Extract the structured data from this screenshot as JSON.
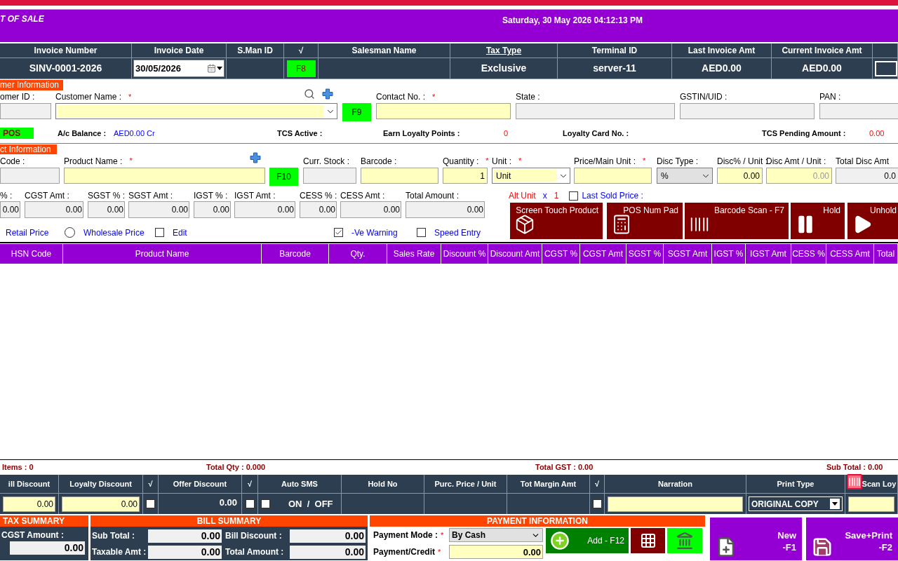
{
  "title_bar": {
    "title": "T OF SALE",
    "datetime": "Saturday, 30 May 2026 04:12:13 PM"
  },
  "invoice_header": [
    {
      "label": "Invoice Number",
      "kind": "text",
      "value": "SINV-0001-2026",
      "underlined": false
    },
    {
      "label": "Invoice Date",
      "kind": "date",
      "value": "30/05/2026",
      "underlined": false
    },
    {
      "label": "S.Man ID",
      "kind": "empty",
      "underlined": false
    },
    {
      "label": "√",
      "kind": "key",
      "value": "F8",
      "underlined": false
    },
    {
      "label": "Salesman Name",
      "kind": "empty",
      "underlined": false
    },
    {
      "label": "Tax Type",
      "kind": "text",
      "value": "Exclusive",
      "underlined": true
    },
    {
      "label": "Terminal ID",
      "kind": "text",
      "value": "server-11",
      "underlined": false
    },
    {
      "label": "Last Invoice Amt",
      "kind": "text",
      "value": "AED0.00",
      "underlined": false
    },
    {
      "label": "Current Invoice Amt",
      "kind": "text",
      "value": "AED0.00",
      "underlined": false
    },
    {
      "kind": "box"
    }
  ],
  "customer": {
    "section_label": "mer Information",
    "fields": [
      {
        "label": "omer ID :",
        "kind": "gray"
      },
      {
        "label": "Customer Name :",
        "mark": "*",
        "kind": "combo"
      },
      {
        "kind": "key",
        "value": "F9"
      },
      {
        "label": "Contact No. :",
        "mark": "*",
        "kind": "yellow"
      },
      {
        "label": "State :",
        "kind": "gray"
      },
      {
        "label": "GSTIN/UID :",
        "kind": "gray"
      },
      {
        "label": "PAN :",
        "kind": "gray"
      }
    ],
    "info": [
      {
        "kind": "badge",
        "text": "POS"
      },
      {
        "kind": "label",
        "text": "A/c Balance :"
      },
      {
        "kind": "link",
        "text": "AED0.00 Cr"
      },
      {
        "kind": "label",
        "text": "TCS Active :"
      },
      {
        "kind": "label",
        "text": "Earn Loyalty Points :"
      },
      {
        "kind": "alert",
        "text": "0"
      },
      {
        "kind": "label",
        "text": "Loyalty Card No. :"
      },
      {
        "kind": "label",
        "text": "TCS Pending Amount :"
      },
      {
        "kind": "alert",
        "text": "0.00"
      }
    ]
  },
  "product": {
    "section_label": "ct Information",
    "fields": [
      {
        "label": "Code :",
        "kind": "gray"
      },
      {
        "label": "Product Name :",
        "mark": "*",
        "kind": "yellow"
      },
      {
        "kind": "key",
        "value": "F10"
      },
      {
        "label": "Curr. Stock :",
        "kind": "gray"
      },
      {
        "label": "Barcode :",
        "kind": "yellow"
      },
      {
        "label": "Quantity :",
        "mark": "*",
        "kind": "yellow",
        "value": "1"
      },
      {
        "label": "Unit :",
        "mark": "*",
        "kind": "combo",
        "value": "Unit"
      },
      {
        "label": "Price/Main Unit :",
        "mark": "*",
        "kind": "yellow"
      },
      {
        "label": "Disc Type :",
        "kind": "select",
        "value": "%"
      },
      {
        "label": "Disc% / Unit :",
        "kind": "yellow",
        "value": "0.00"
      },
      {
        "label": "Disc Amt / Unit :",
        "kind": "yellow",
        "placeholder": "0.00"
      },
      {
        "label": "Total Disc Amt",
        "kind": "gray",
        "value": "0.0"
      }
    ],
    "tax_fields": [
      {
        "label": "% :",
        "value": "0.00"
      },
      {
        "label": "CGST Amt :",
        "value": "0.00"
      },
      {
        "label": "SGST % :",
        "value": "0.00"
      },
      {
        "label": "SGST Amt :",
        "value": "0.00"
      },
      {
        "label": "IGST % :",
        "value": "0.00"
      },
      {
        "label": "IGST Amt :",
        "value": "0.00"
      },
      {
        "label": "CESS % :",
        "value": "0.00"
      },
      {
        "label": "CESS Amt :",
        "value": "0.00"
      },
      {
        "label": "Total Amount :",
        "value": "0.00"
      }
    ],
    "options": [
      {
        "kind": "label",
        "text": "Retail Price"
      },
      {
        "kind": "radio",
        "text": "Wholesale Price",
        "selected": false
      },
      {
        "kind": "checkbox",
        "text": "Edit",
        "checked": false
      },
      {
        "kind": "checkbox",
        "text": "-Ve Warning",
        "checked": true
      },
      {
        "kind": "checkbox",
        "text": "Speed Entry",
        "checked": false
      }
    ],
    "alt_unit": {
      "label": "Alt Unit",
      "times": "x",
      "factor": "1"
    },
    "last_sold_price": {
      "label": "Last Sold Price :",
      "checked": false
    },
    "actions": [
      {
        "kind": "box",
        "label": "Screen Touch Product"
      },
      {
        "kind": "numpad",
        "label": "POS Num Pad"
      },
      {
        "kind": "barcode",
        "label": "Barcode Scan - F7"
      },
      {
        "kind": "pause",
        "label": "Hold"
      },
      {
        "kind": "play",
        "label": "Unhold"
      }
    ]
  },
  "grid": {
    "columns": [
      "HSN Code",
      "Product Name",
      "Barcode",
      "Qty.",
      "Sales Rate",
      "Discount %",
      "Discount Amt",
      "CGST %",
      "CGST Amt",
      "SGST %",
      "SGST Amt",
      "IGST %",
      "IGST Amt",
      "CESS %",
      "CESS Amt",
      "Total"
    ]
  },
  "totals": [
    "Items : 0",
    "Total Qty : 0.000",
    "Total GST : 0.00",
    "Sub Total : 0.00"
  ],
  "footer_table": [
    {
      "label": "ill Discount",
      "kind": "input",
      "value": "0.00"
    },
    {
      "label": "Loyalty Discount",
      "kind": "input",
      "value": "0.00"
    },
    {
      "label": "√",
      "kind": "checkbox",
      "checked": false
    },
    {
      "label": "Offer Discount",
      "kind": "text",
      "value": "0.00"
    },
    {
      "label": "√",
      "kind": "checkbox",
      "checked": false
    },
    {
      "label": "Auto SMS",
      "kind": "toggle",
      "checked": false,
      "value": "ON  /  OFF"
    },
    {
      "label": "Hold No",
      "kind": "empty"
    },
    {
      "label": "Purc. Price / Unit",
      "kind": "empty"
    },
    {
      "label": "Tot Margin Amt",
      "kind": "empty"
    },
    {
      "label": "√",
      "kind": "checkbox",
      "checked": false
    },
    {
      "label": "Narration",
      "kind": "input"
    },
    {
      "label": "Print Type",
      "kind": "select",
      "value": "ORIGINAL COPY"
    },
    {
      "label": "Scan Loy",
      "kind": "scan"
    }
  ],
  "tax_summary": {
    "title": "TAX SUMMARY",
    "rows": [
      {
        "label": "CGST Amount :",
        "value": "0.00"
      }
    ]
  },
  "bill_summary": {
    "title": "BILL SUMMARY",
    "rows": [
      {
        "label": "Sub Total :",
        "value": "0.00"
      },
      {
        "label": "Bill Discount :",
        "value": "0.00"
      },
      {
        "label": "Taxable Amt :",
        "value": "0.00"
      },
      {
        "label": "Total Amount :",
        "value": "0.00"
      }
    ]
  },
  "payment": {
    "title": "PAYMENT INFORMATION",
    "fields": [
      {
        "label": "Payment Mode :",
        "mark": "*",
        "kind": "select",
        "value": "By Cash"
      },
      {
        "label": "Payment/Credit",
        "mark": "*",
        "kind": "input",
        "value": "0.00"
      }
    ],
    "buttons": [
      {
        "kind": "add",
        "label": "Add - F12"
      },
      {
        "kind": "keypad"
      },
      {
        "kind": "bank"
      }
    ]
  },
  "main_buttons": [
    {
      "kind": "new",
      "label": "New",
      "key": "-F1"
    },
    {
      "kind": "save",
      "label": "Save+Print",
      "key": "-F2"
    }
  ]
}
